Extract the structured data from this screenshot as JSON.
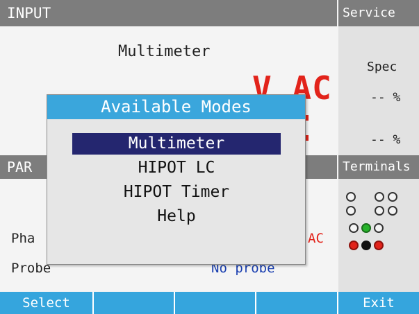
{
  "input_panel": {
    "title": "INPUT",
    "function_label": "Multimeter",
    "reading_unit": "V AC"
  },
  "service_panel": {
    "title": "Service",
    "spec_label": "Spec",
    "spec_value_1": "-- %",
    "spec_value_2": "-- %"
  },
  "parameters_panel": {
    "title": "PAR",
    "phase_label": "Pha",
    "phase_value": "AC",
    "probe_label": "Probe",
    "probe_value": "No probe"
  },
  "terminals_panel": {
    "title": "Terminals",
    "colors": {
      "open": "#f4f4f4",
      "active_green": "#26b32a",
      "active_red": "#e2231a",
      "common_black": "#111111"
    }
  },
  "modal": {
    "title": "Available Modes",
    "modes": [
      {
        "label": "Multimeter",
        "selected": true
      },
      {
        "label": "HIPOT LC",
        "selected": false
      },
      {
        "label": "HIPOT Timer",
        "selected": false
      },
      {
        "label": "Help",
        "selected": false
      }
    ]
  },
  "softkeys": {
    "key1": "Select",
    "key2": "",
    "key3": "",
    "key4": "",
    "key5": "Exit"
  },
  "colors": {
    "header_gray": "#7d7d7d",
    "accent_blue": "#3aa6dc",
    "selection_navy": "#24266f",
    "reading_red": "#e2231a",
    "probe_blue": "#1a3fb0"
  }
}
